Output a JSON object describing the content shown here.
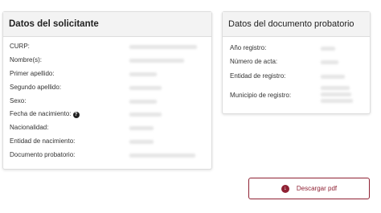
{
  "applicant": {
    "title": "Datos del solicitante",
    "rows": [
      {
        "label": "CURP:"
      },
      {
        "label": "Nombre(s):"
      },
      {
        "label": "Primer apellido:"
      },
      {
        "label": "Segundo apellido:"
      },
      {
        "label": "Sexo:"
      },
      {
        "label": "Fecha de nacimiento:"
      },
      {
        "label": "Nacionalidad:"
      },
      {
        "label": "Entidad de nacimiento:"
      },
      {
        "label": "Documento probatorio:"
      }
    ]
  },
  "document": {
    "title": "Datos del documento probatorio",
    "rows": [
      {
        "label": "Año registro:"
      },
      {
        "label": "Número de acta:"
      },
      {
        "label": "Entidad de registro:"
      },
      {
        "label": "Municipio de registro:"
      }
    ]
  },
  "actions": {
    "download_label": "Descargar pdf",
    "download_icon": "download-icon"
  },
  "colors": {
    "accent": "#8f2133",
    "header_bg": "#f3f3f3"
  }
}
